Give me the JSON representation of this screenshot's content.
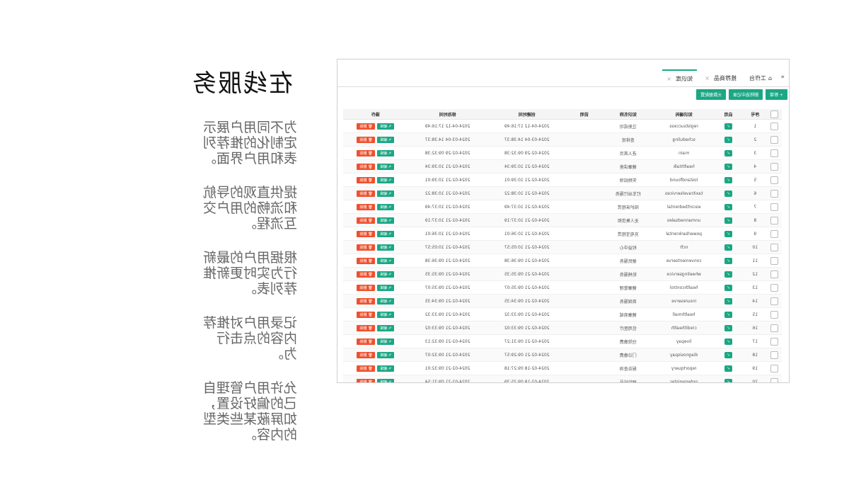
{
  "slide": {
    "title": "在线服务",
    "paragraphs": [
      "为不同用户展示定制化的推荐列表和用户界面。",
      "提供直观的导航和流畅的用户交互流程。",
      "根据用户的最新行为实时更新推荐列表。",
      "记录用户对推荐内容的点击行为。",
      "允许用户管理自己的偏好设置，如屏蔽某些类型的内容。"
    ]
  },
  "app": {
    "tabs": [
      {
        "label": "工作台"
      },
      {
        "label": "推荐商品"
      },
      {
        "label": "知识库"
      }
    ],
    "toolbar": {
      "add_label": "+ 新增",
      "delete_label": "删除选中记录",
      "sort_label": "元数据配置"
    },
    "columns": [
      "",
      "序号",
      "启用",
      "知识编码",
      "知识名称",
      "说明",
      "创建时间",
      "修改时间",
      "操作"
    ],
    "row_actions": {
      "edit": "编辑",
      "delete": "删除"
    },
    "rows": [
      {
        "no": "1",
        "code": "registsuccess",
        "name": "注册成功",
        "created": "2024-04-12 17:16:49",
        "modified": "2024-04-12 17:16:49"
      },
      {
        "no": "2",
        "code": "scheduling",
        "name": "查排班",
        "created": "2024-03-04 14:38:37",
        "modified": "2024-03-04 14:38:37"
      },
      {
        "no": "3",
        "code": "main",
        "name": "进入首页",
        "created": "2024-02-29 09:32:38",
        "modified": "2024-02-29 09:32:38"
      },
      {
        "no": "4",
        "code": "healthtalk",
        "name": "健康讲座",
        "created": "2024-02-21 10:39:34",
        "modified": "2024-02-21 10:39:34"
      },
      {
        "no": "5",
        "code": "lostandfound",
        "name": "失物招领",
        "created": "2024-02-21 10:39:01",
        "modified": "2024-02-21 10:39:01"
      },
      {
        "no": "6",
        "code": "taxitravelservices",
        "name": "打车出行服务",
        "created": "2024-02-21 10:38:22",
        "modified": "2024-02-21 10:38:22"
      },
      {
        "no": "7",
        "code": "escortbedrental",
        "name": "陪护床租赁",
        "created": "2024-02-21 10:37:49",
        "modified": "2024-02-21 10:37:49"
      },
      {
        "no": "8",
        "code": "unmannedsales",
        "name": "无人售货柜",
        "created": "2024-02-21 10:37:19",
        "modified": "2024-02-21 10:37:19"
      },
      {
        "no": "9",
        "code": "powerbankrental",
        "name": "充电宝租赁",
        "created": "2024-02-21 10:36:01",
        "modified": "2024-02-21 10:36:01"
      },
      {
        "no": "10",
        "code": "ncfr",
        "name": "权益中心",
        "created": "2024-02-21 10:05:57",
        "modified": "2024-02-21 10:05:57"
      },
      {
        "no": "11",
        "code": "convenientserve",
        "name": "便民服务",
        "created": "2024-02-21 09:36:38",
        "modified": "2024-02-21 09:36:38"
      },
      {
        "no": "12",
        "code": "wheelingservice",
        "name": "轮椅服务",
        "created": "2024-02-21 09:35:35",
        "modified": "2024-02-21 09:35:35"
      },
      {
        "no": "13",
        "code": "healthcontrol",
        "name": "健康管理",
        "created": "2024-02-21 09:35:07",
        "modified": "2024-02-21 09:35:07"
      },
      {
        "no": "14",
        "code": "insureserve",
        "name": "商保服务",
        "created": "2024-02-21 09:34:35",
        "modified": "2024-02-21 09:34:35"
      },
      {
        "no": "15",
        "code": "healthmall",
        "name": "健康商城",
        "created": "2024-02-21 09:33:32",
        "modified": "2024-02-21 09:33:32"
      },
      {
        "no": "16",
        "code": "credithealth",
        "name": "信用医疗",
        "created": "2024-02-21 09:33:02",
        "modified": "2024-02-21 09:33:02"
      },
      {
        "no": "17",
        "code": "livepay",
        "name": "住院缴费",
        "created": "2024-02-21 09:31:27",
        "modified": "2024-02-21 09:32:13"
      },
      {
        "no": "18",
        "code": "diagnosispay",
        "name": "门诊缴费",
        "created": "2024-02-21 09:29:57",
        "modified": "2024-02-21 09:32:07"
      },
      {
        "no": "19",
        "code": "reportquery",
        "name": "报告查询",
        "created": "2024-02-18 09:27:18",
        "modified": "2024-02-21 09:32:01"
      },
      {
        "no": "20",
        "code": "orderregister",
        "name": "预约挂号",
        "created": "2024-02-18 09:25:39",
        "modified": "2024-02-21 09:31:54"
      }
    ]
  }
}
